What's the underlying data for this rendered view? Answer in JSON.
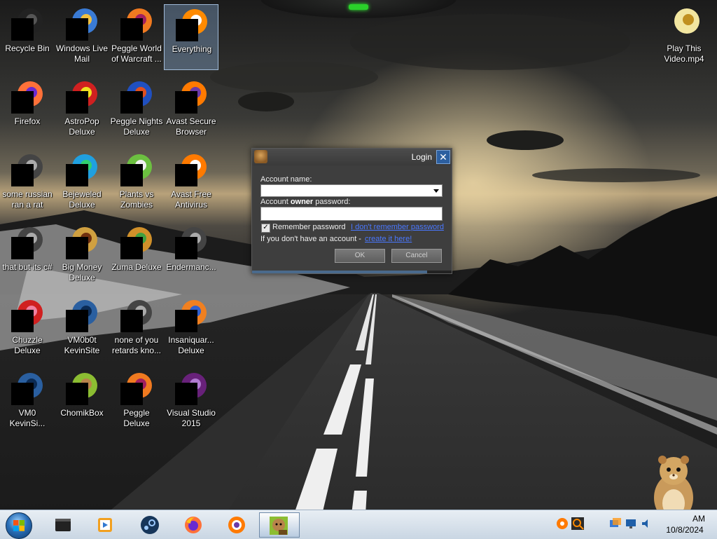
{
  "desktop": {
    "icons": [
      {
        "id": "recycle-bin",
        "label": "Recycle Bin",
        "icon": "recycle-bin-icon"
      },
      {
        "id": "windows-live-mail",
        "label": "Windows Live\nMail",
        "icon": "mail-icon"
      },
      {
        "id": "peggle-world-of-warcraft",
        "label": "Peggle World\nof Warcraft ...",
        "icon": "peggle-icon"
      },
      {
        "id": "everything",
        "label": "Everything",
        "icon": "everything-search-icon"
      },
      {
        "id": "firefox",
        "label": "Firefox",
        "icon": "firefox-icon"
      },
      {
        "id": "astropop-deluxe",
        "label": "AstroPop\nDeluxe",
        "icon": "astropop-icon"
      },
      {
        "id": "peggle-nights-deluxe",
        "label": "Peggle Nights\nDeluxe",
        "icon": "peggle-nights-icon"
      },
      {
        "id": "avast-secure-browser",
        "label": "Avast Secure\nBrowser",
        "icon": "avast-browser-icon"
      },
      {
        "id": "some-russian-ran-a-rat",
        "label": "some russian\nran a rat",
        "icon": "shortcut-icon"
      },
      {
        "id": "bejeweled-deluxe",
        "label": "Bejeweled\nDeluxe",
        "icon": "bejeweled-icon"
      },
      {
        "id": "plants-vs-zombies",
        "label": "Plants vs\nZombies",
        "icon": "pvz-icon"
      },
      {
        "id": "avast-free-antivirus",
        "label": "Avast Free\nAntivirus",
        "icon": "avast-antivirus-icon"
      },
      {
        "id": "that-but-its-c",
        "label": "that but its c#",
        "icon": "shortcut-icon"
      },
      {
        "id": "big-money-deluxe",
        "label": "Big Money\nDeluxe",
        "icon": "big-money-icon"
      },
      {
        "id": "zuma-deluxe",
        "label": "Zuma Deluxe",
        "icon": "zuma-icon"
      },
      {
        "id": "endermanc",
        "label": "Endermanc...",
        "icon": "shortcut-icon"
      },
      {
        "id": "chuzzle-deluxe",
        "label": "Chuzzle\nDeluxe",
        "icon": "chuzzle-icon"
      },
      {
        "id": "vm0b0t-kevinsite",
        "label": "VM0b0t\nKevinSite",
        "icon": "vm-icon"
      },
      {
        "id": "none-of-you-retards",
        "label": "none of you\nretards kno...",
        "icon": "shortcut-icon"
      },
      {
        "id": "insaniquarium-deluxe",
        "label": "Insaniquar...\nDeluxe",
        "icon": "insaniquarium-icon"
      },
      {
        "id": "vm0-kevinsi",
        "label": "VM0\nKevinSi...",
        "icon": "vm-icon"
      },
      {
        "id": "chomikbox",
        "label": "ChomikBox",
        "icon": "chomikbox-icon"
      },
      {
        "id": "peggle-deluxe",
        "label": "Peggle Deluxe",
        "icon": "peggle-icon"
      },
      {
        "id": "visual-studio-2015",
        "label": "Visual Studio\n2015",
        "icon": "visual-studio-icon"
      },
      {
        "id": "play-this-video",
        "label": "Play This\nVideo.mp4",
        "icon": "video-file-icon"
      }
    ]
  },
  "login": {
    "title": "Login",
    "account_name_label": "Account name:",
    "password_label_pre": "Account",
    "password_label_bold": "owner",
    "password_label_post": "password:",
    "remember_label": "Remember password",
    "remember_checked": true,
    "forgot_link": "I don't remember password",
    "no_account_text": "If you don't have an account -",
    "create_link": "create it here!",
    "ok_label": "OK",
    "cancel_label": "Cancel"
  },
  "taskbar": {
    "pinned": [
      "terminal-icon",
      "media-player-icon",
      "steam-icon",
      "firefox-icon",
      "avast-browser-icon",
      "chomikbox-icon"
    ],
    "active": "chomikbox-icon",
    "time": "AM",
    "date": "10/8/2024"
  }
}
